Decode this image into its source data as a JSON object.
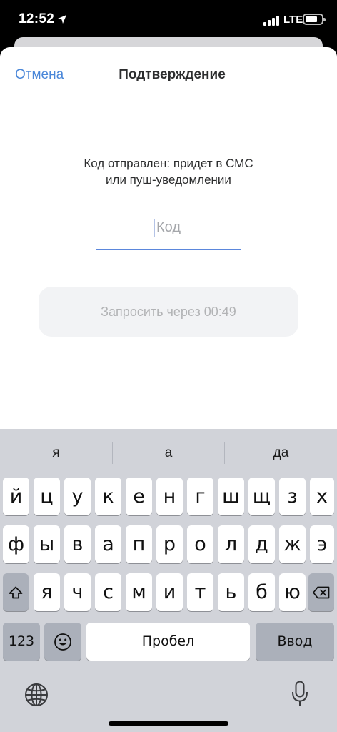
{
  "status_bar": {
    "time": "12:52",
    "network": "LTE"
  },
  "header": {
    "cancel_label": "Отмена",
    "title": "Подтверждение"
  },
  "message": {
    "line1": "Код отправлен: придет в СМС",
    "line2": "или пуш-уведомлении"
  },
  "code_input": {
    "placeholder": "Код",
    "value": ""
  },
  "resend_button": {
    "label": "Запросить через 00:49"
  },
  "keyboard": {
    "suggestions": [
      "я",
      "а",
      "да"
    ],
    "row1": [
      "й",
      "ц",
      "у",
      "к",
      "е",
      "н",
      "г",
      "ш",
      "щ",
      "з",
      "х"
    ],
    "row2": [
      "ф",
      "ы",
      "в",
      "а",
      "п",
      "р",
      "о",
      "л",
      "д",
      "ж",
      "э"
    ],
    "row3": [
      "я",
      "ч",
      "с",
      "м",
      "и",
      "т",
      "ь",
      "б",
      "ю"
    ],
    "numbers_label": "123",
    "space_label": "Пробел",
    "return_label": "Ввод",
    "icons": [
      "location-arrow-icon",
      "shift-icon",
      "backspace-icon",
      "emoji-icon",
      "globe-icon",
      "microphone-icon"
    ]
  },
  "colors": {
    "accent": "#4a87d9",
    "underline": "#5b87dc",
    "keyboard_bg": "#d1d3d9"
  }
}
